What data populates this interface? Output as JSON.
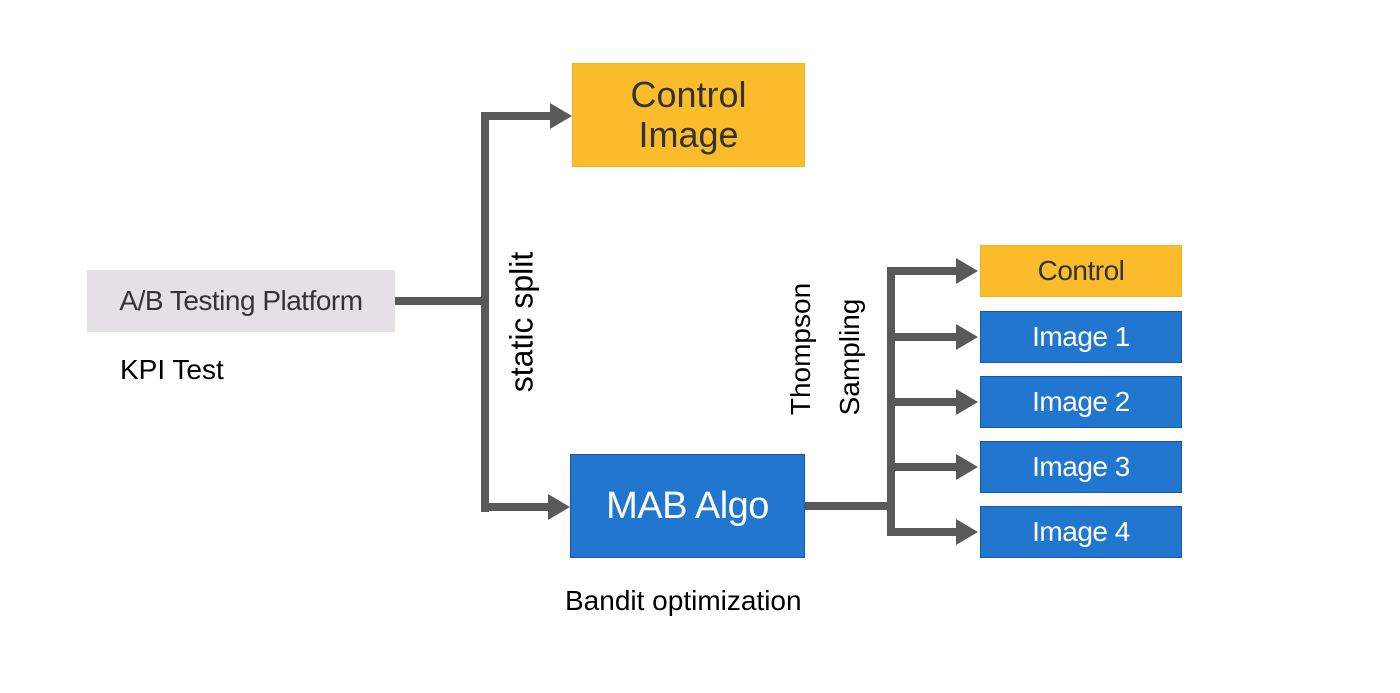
{
  "colors": {
    "platform_fill": "#e4e0e6",
    "control_fill": "#fbbc2c",
    "control_border": "#f6b321",
    "variant_fill": "#2176cf",
    "variant_border": "#1656a6",
    "connector": "#595959",
    "dark_text": "#333333",
    "black_text": "#000000",
    "white_text": "#ffffff"
  },
  "platform": {
    "label": "A/B Testing Platform",
    "caption": "KPI Test"
  },
  "split": {
    "label": "static split"
  },
  "control_image": {
    "line1": "Control",
    "line2": "Image"
  },
  "mab": {
    "label": "MAB Algo",
    "caption": "Bandit optimization"
  },
  "sampling": {
    "line1": "Thompson",
    "line2": "Sampling"
  },
  "arms": [
    {
      "label": "Control",
      "kind": "control"
    },
    {
      "label": "Image 1",
      "kind": "variant"
    },
    {
      "label": "Image 2",
      "kind": "variant"
    },
    {
      "label": "Image 3",
      "kind": "variant"
    },
    {
      "label": "Image 4",
      "kind": "variant"
    }
  ]
}
